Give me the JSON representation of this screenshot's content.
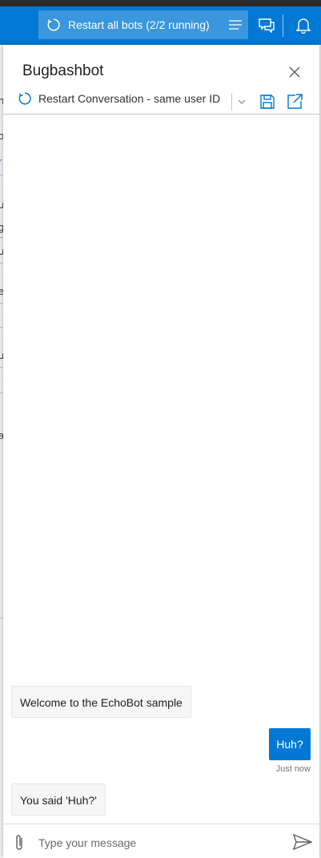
{
  "topbar": {
    "restart_all_label": "Restart all bots (2/2 running)"
  },
  "background_page": {
    "fragments": [
      "n",
      "i",
      "o",
      "r",
      "u",
      "g",
      "u",
      "e",
      "u",
      "al"
    ]
  },
  "panel": {
    "title": "Bugbashbot",
    "toolbar": {
      "restart_label": "Restart Conversation - same user ID"
    }
  },
  "messages": [
    {
      "from": "bot",
      "text": "Welcome to the EchoBot sample"
    },
    {
      "from": "user",
      "text": "Huh?",
      "timestamp": "Just now"
    },
    {
      "from": "bot",
      "text": "You said 'Huh?'"
    }
  ],
  "composer": {
    "placeholder": "Type your message"
  },
  "colors": {
    "accent": "#0078d4",
    "topbar_button": "#3a96dd",
    "bot_bubble": "#f6f6f6"
  },
  "icons": [
    "refresh-icon",
    "hamburger-menu-icon",
    "chat-icon",
    "bell-icon",
    "close-icon",
    "chevron-down-icon",
    "save-icon",
    "open-external-icon",
    "paperclip-icon",
    "send-icon"
  ]
}
